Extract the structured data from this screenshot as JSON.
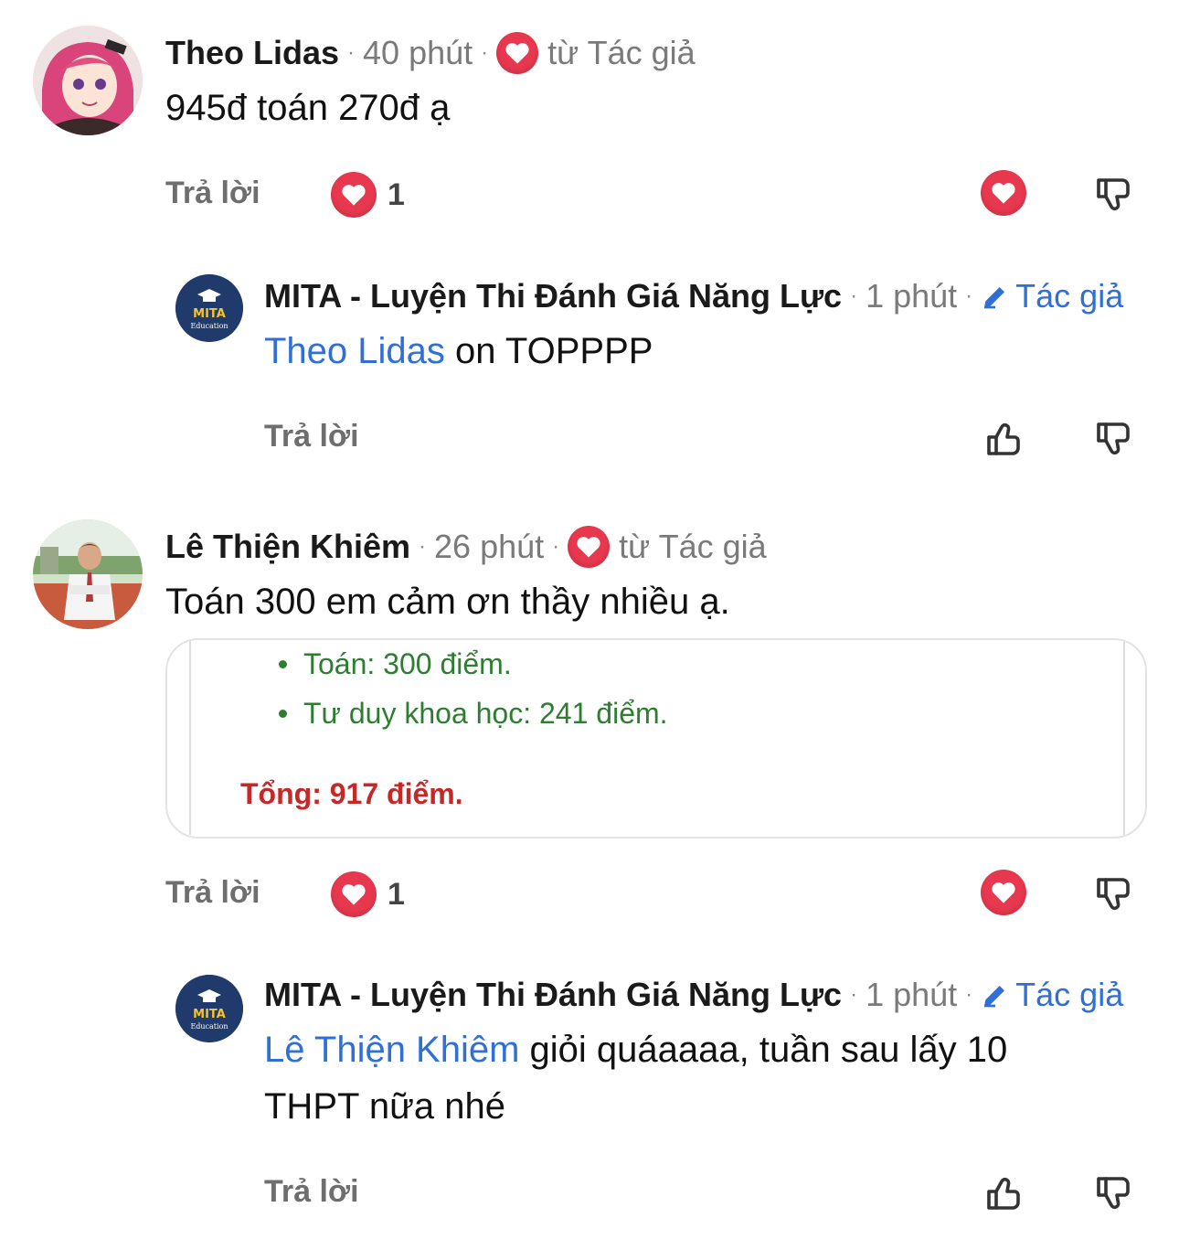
{
  "comments": [
    {
      "author": "Theo Lidas",
      "time": "40 phút",
      "from_author_label": "từ Tác giả",
      "text": "945đ toán 270đ ạ",
      "reply_label": "Trả lời",
      "like_count": "1",
      "reply": {
        "author": "MITA - Luyện Thi Đánh Giá Năng Lực",
        "time": "1 phút",
        "author_tag": "Tác giả",
        "mention": "Theo Lidas",
        "text": " on TOPPPP",
        "reply_label": "Trả lời",
        "avatar_brand": "MITA",
        "avatar_sub": "Education"
      }
    },
    {
      "author": "Lê Thiện Khiêm",
      "time": "26 phút",
      "from_author_label": "từ Tác giả",
      "text": "Toán 300 em cảm ơn thầy nhiều ạ.",
      "reply_label": "Trả lời",
      "like_count": "1",
      "attachment": {
        "lines": [
          "Toán: 300 điểm.",
          "Tư duy khoa học: 241 điểm."
        ],
        "total": "Tổng: 917 điểm."
      },
      "reply": {
        "author": "MITA - Luyện Thi Đánh Giá Năng Lực",
        "time": "1 phút",
        "author_tag": "Tác giả",
        "mention": "Lê Thiện Khiêm",
        "text_line1": " giỏi quáaaaa, tuần sau lấy 10",
        "text_line2": "THPT nữa nhé",
        "reply_label": "Trả lời",
        "avatar_brand": "MITA",
        "avatar_sub": "Education"
      }
    }
  ],
  "icons": [
    "heart-icon",
    "thumbs-down-icon",
    "thumbs-up-icon",
    "pencil-icon"
  ],
  "colors": {
    "heart": "#e8384f",
    "link": "#2f6fd6",
    "muted": "#7a7a7a",
    "attachment_green": "#2e7d32",
    "attachment_red": "#c62828"
  }
}
